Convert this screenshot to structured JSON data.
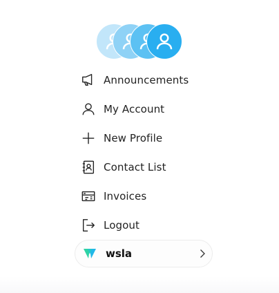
{
  "colors": {
    "avatar_accent": "#29aef0",
    "org_logo_left": "#2ed3a4",
    "org_logo_right": "#21b8e8"
  },
  "avatars": [
    {
      "icon": "user-icon"
    },
    {
      "icon": "user-icon"
    },
    {
      "icon": "user-icon"
    },
    {
      "icon": "user-icon"
    }
  ],
  "menu": {
    "items": [
      {
        "icon": "megaphone-icon",
        "label": "Announcements"
      },
      {
        "icon": "user-icon",
        "label": "My Account"
      },
      {
        "icon": "plus-icon",
        "label": "New Profile"
      },
      {
        "icon": "contact-book-icon",
        "label": "Contact List"
      },
      {
        "icon": "invoice-icon",
        "label": "Invoices"
      },
      {
        "icon": "logout-icon",
        "label": "Logout"
      }
    ]
  },
  "organization": {
    "name": "wsla",
    "icon": "chevron-right-icon"
  }
}
